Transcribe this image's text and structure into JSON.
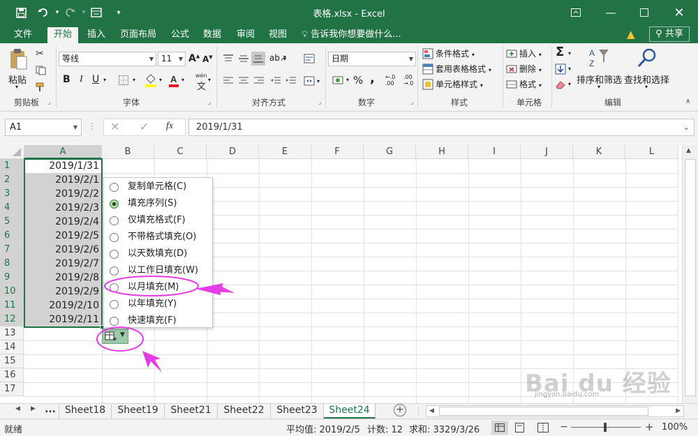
{
  "window": {
    "title": "表格.xlsx - Excel"
  },
  "menu": {
    "tabs": [
      "文件",
      "开始",
      "插入",
      "页面布局",
      "公式",
      "数据",
      "审阅",
      "视图"
    ],
    "active": "开始",
    "tell_me": "告诉我你想要做什么...",
    "share": "共享"
  },
  "ribbon": {
    "clipboard": {
      "paste": "粘贴",
      "label": "剪贴板"
    },
    "font": {
      "name": "等线",
      "size": "11",
      "label": "字体",
      "wen": "wén",
      "wen2": "文"
    },
    "alignment": {
      "label": "对齐方式"
    },
    "number": {
      "format": "日期",
      "label": "数字",
      "percent": "%",
      "comma": ",",
      "inc": "←.0 .00",
      "dec": ".00 →.0"
    },
    "styles": {
      "conditional": "条件格式",
      "table": "套用表格格式",
      "cell": "单元格样式",
      "label": "样式"
    },
    "cells": {
      "insert": "插入",
      "delete": "删除",
      "format": "格式",
      "label": "单元格"
    },
    "editing": {
      "sort": "排序和筛选",
      "find": "查找和选择",
      "label": "编辑"
    }
  },
  "formula_bar": {
    "name_box": "A1",
    "formula": "2019/1/31",
    "fx": "fx"
  },
  "grid": {
    "columns": [
      "A",
      "B",
      "C",
      "D",
      "E",
      "F",
      "G",
      "H",
      "I",
      "J",
      "K",
      "L"
    ],
    "rows": [
      "1",
      "2",
      "3",
      "4",
      "5",
      "6",
      "7",
      "8",
      "9",
      "10",
      "11",
      "12",
      "13",
      "14",
      "15",
      "16",
      "17"
    ],
    "column_a_values": [
      "2019/1/31",
      "2019/2/1",
      "2019/2/2",
      "2019/2/3",
      "2019/2/4",
      "2019/2/5",
      "2019/2/6",
      "2019/2/7",
      "2019/2/8",
      "2019/2/9",
      "2019/2/10",
      "2019/2/11"
    ]
  },
  "autofill_menu": {
    "selected_index": 1,
    "highlighted_index": 6,
    "options": [
      {
        "label": "复制单元格(C)",
        "key": "C"
      },
      {
        "label": "填充序列(S)",
        "key": "S"
      },
      {
        "label": "仅填充格式(F)",
        "key": "F"
      },
      {
        "label": "不带格式填充(O)",
        "key": "O"
      },
      {
        "label": "以天数填充(D)",
        "key": "D"
      },
      {
        "label": "以工作日填充(W)",
        "key": "W"
      },
      {
        "label": "以月填充(M)",
        "key": "M"
      },
      {
        "label": "以年填充(Y)",
        "key": "Y"
      },
      {
        "label": "快速填充(F)",
        "key": "F"
      }
    ]
  },
  "sheets": {
    "more": "...",
    "tabs": [
      "Sheet18",
      "Sheet19",
      "Sheet21",
      "Sheet22",
      "Sheet23",
      "Sheet24"
    ],
    "active": "Sheet24"
  },
  "status_bar": {
    "ready": "就绪",
    "average": "平均值: 2019/2/5",
    "count": "计数: 12",
    "sum": "求和: 3329/3/26",
    "zoom": "100%"
  },
  "watermark": {
    "text": "jingyan.baidu.com",
    "logo": "Bai du 经验"
  },
  "colors": {
    "excel_green": "#217346",
    "annotation": "#e63ce6",
    "selection": "#d2d2d2"
  }
}
